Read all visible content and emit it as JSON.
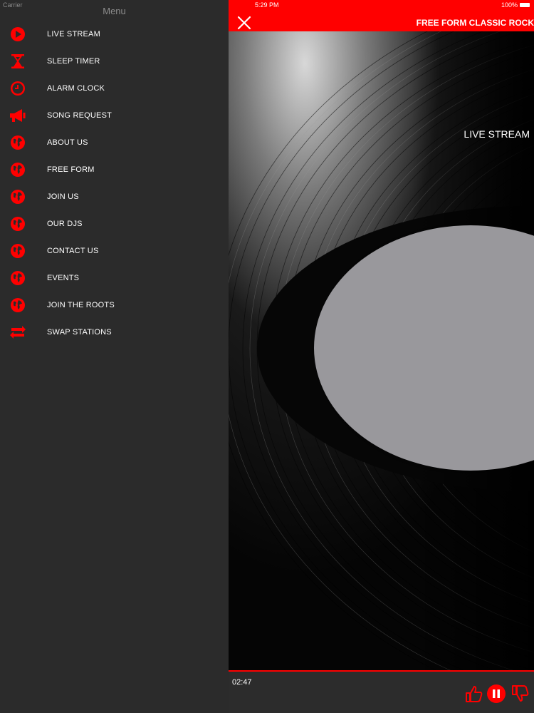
{
  "status_bar": {
    "carrier": "Carrier",
    "time": "5:29 PM",
    "battery": "100%"
  },
  "drawer": {
    "title": "Menu",
    "items": [
      {
        "label": "LIVE STREAM",
        "icon": "play-circle-icon"
      },
      {
        "label": "SLEEP TIMER",
        "icon": "hourglass-icon"
      },
      {
        "label": "ALARM CLOCK",
        "icon": "clock-icon"
      },
      {
        "label": "SONG REQUEST",
        "icon": "megaphone-icon"
      },
      {
        "label": "ABOUT US",
        "icon": "globe-icon"
      },
      {
        "label": "FREE FORM",
        "icon": "globe-icon"
      },
      {
        "label": "JOIN US",
        "icon": "globe-icon"
      },
      {
        "label": "OUR DJS",
        "icon": "globe-icon"
      },
      {
        "label": "CONTACT US",
        "icon": "globe-icon"
      },
      {
        "label": "EVENTS",
        "icon": "globe-icon"
      },
      {
        "label": "JOIN THE ROOTS",
        "icon": "globe-icon"
      },
      {
        "label": "SWAP STATIONS",
        "icon": "swap-icon"
      }
    ]
  },
  "header": {
    "station_title": "FREE FORM CLASSIC ROCK"
  },
  "player": {
    "now_label": "LIVE STREAM",
    "elapsed": "02:47"
  },
  "colors": {
    "accent": "#ff0000",
    "drawer_bg": "#2b2b2b",
    "label_center": "#99989c"
  }
}
